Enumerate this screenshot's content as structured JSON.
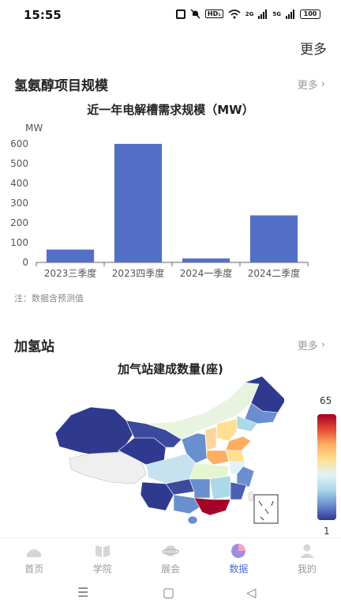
{
  "status": {
    "time": "15:55",
    "hd_badge": "HD₁",
    "signal1": "2G",
    "signal2": "5G",
    "battery": "100"
  },
  "top_more": "更多",
  "sections": {
    "project": {
      "title": "氢氨醇项目规模",
      "more": "更多"
    },
    "station": {
      "title": "加氢站",
      "more": "更多"
    }
  },
  "chart_data": [
    {
      "type": "bar",
      "title": "近一年电解槽需求规模（MW）",
      "ylabel": "MW",
      "categories": [
        "2023三季度",
        "2023四季度",
        "2024一季度",
        "2024二季度"
      ],
      "values": [
        65,
        600,
        20,
        238
      ],
      "ylim": [
        0,
        600
      ],
      "yticks": [
        0,
        100,
        200,
        300,
        400,
        500,
        600
      ],
      "bar_color": "#5470c6",
      "grid": false
    }
  ],
  "note": "注：数据含预测值",
  "map": {
    "title": "加气站建成数量(座)",
    "scale_max": "65",
    "scale_min": "1"
  },
  "tabs": [
    {
      "label": "首页",
      "icon": "home-icon",
      "active": false
    },
    {
      "label": "学院",
      "icon": "book-icon",
      "active": false
    },
    {
      "label": "展会",
      "icon": "planet-icon",
      "active": false
    },
    {
      "label": "数据",
      "icon": "pie-chart-icon",
      "active": true
    },
    {
      "label": "我的",
      "icon": "user-icon",
      "active": false
    }
  ],
  "colors": {
    "accent": "#4e6bd6",
    "bar": "#5470c6"
  }
}
